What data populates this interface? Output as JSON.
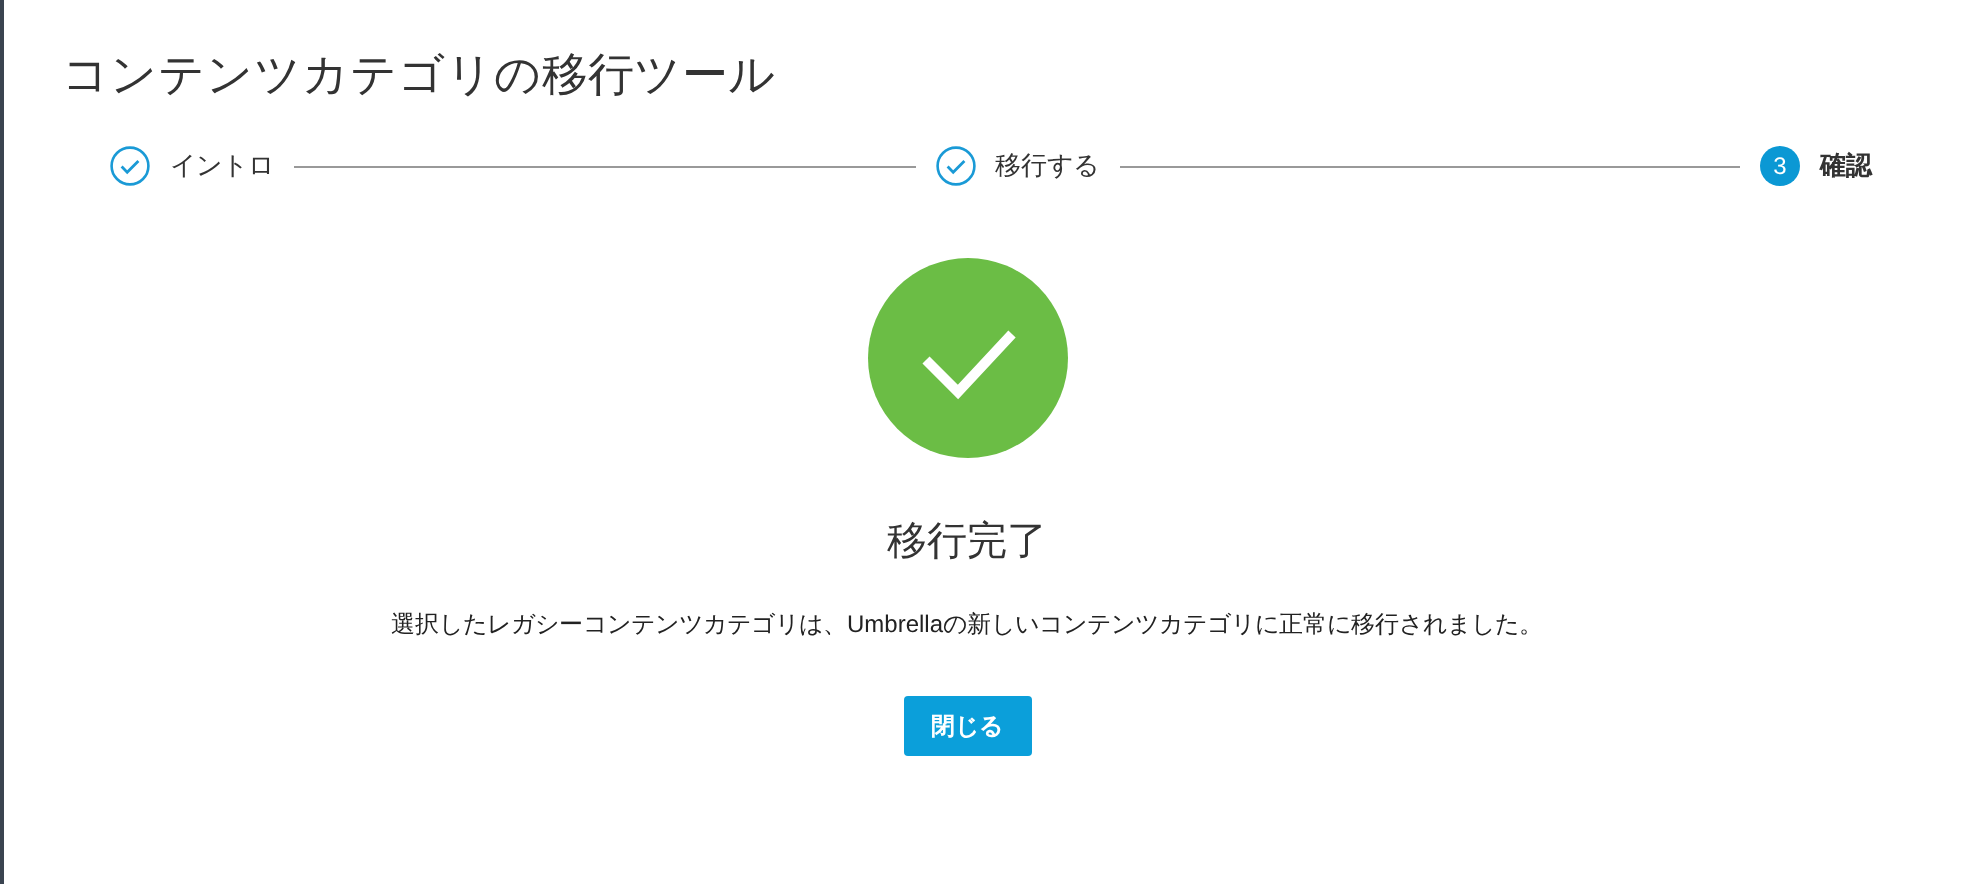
{
  "dialog": {
    "title": "コンテンツカテゴリの移行ツール"
  },
  "steps": [
    {
      "label": "イントロ",
      "completed": true,
      "selected": false
    },
    {
      "label": "移行する",
      "completed": true,
      "selected": false
    },
    {
      "label": "確認",
      "completed": false,
      "selected": true,
      "number": "3"
    }
  ],
  "result": {
    "heading": "移行完了",
    "message": "選択したレガシーコンテンツカテゴリは、Umbrellaの新しいコンテンツカテゴリに正常に移行されました。"
  },
  "buttons": [
    {
      "label": "閉じる"
    }
  ]
}
